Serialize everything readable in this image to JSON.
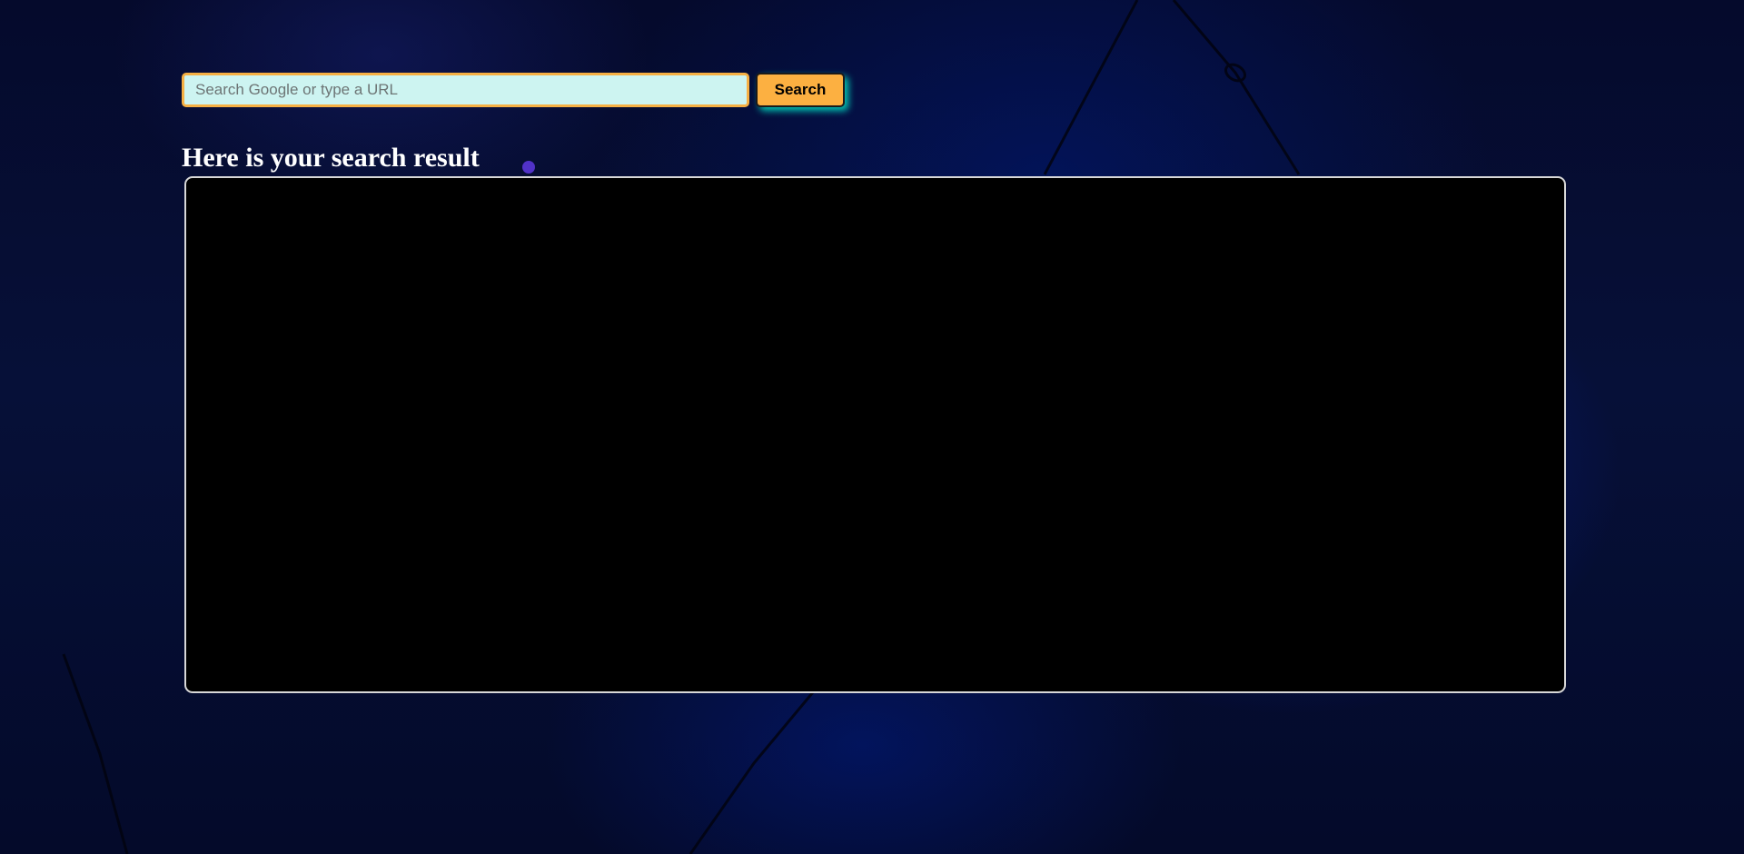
{
  "search": {
    "placeholder": "Search Google or type a URL",
    "value": "",
    "button_label": "Search"
  },
  "result": {
    "heading": "Here is your search result",
    "content": ""
  },
  "colors": {
    "input_background": "#cdf4f1",
    "input_border": "#f6b044",
    "button_background": "#fcb041",
    "button_glow": "#00e6c8",
    "result_background": "#000000",
    "result_border": "#d8d8d8",
    "page_background": "#061038"
  }
}
